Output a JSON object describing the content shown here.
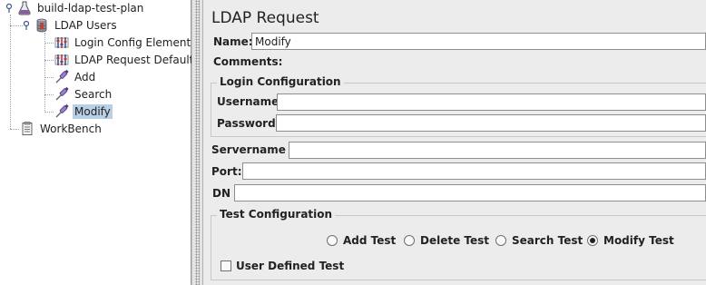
{
  "tree": {
    "root": {
      "label": "build-ldap-test-plan",
      "icon": "test-plan-icon"
    },
    "thread_group": {
      "label": "LDAP Users",
      "icon": "thread-group-icon"
    },
    "children": [
      {
        "label": "Login Config Element",
        "icon": "config-element-icon"
      },
      {
        "label": "LDAP Request Defaults",
        "icon": "config-element-icon"
      },
      {
        "label": "Add",
        "icon": "sampler-icon"
      },
      {
        "label": "Search",
        "icon": "sampler-icon"
      },
      {
        "label": "Modify",
        "icon": "sampler-icon",
        "selected": true
      }
    ],
    "workbench": {
      "label": "WorkBench",
      "icon": "workbench-icon"
    }
  },
  "panel": {
    "title": "LDAP Request",
    "name_label": "Name:",
    "name_value": "Modify",
    "comments_label": "Comments:",
    "login_group_title": "Login Configuration",
    "username_label": "Username",
    "username_value": "",
    "password_label": "Password",
    "password_value": "",
    "servername_label": "Servername :",
    "servername_value": "",
    "port_label": "Port:",
    "port_value": "",
    "dn_label": "DN",
    "dn_value": "",
    "test_group_title": "Test Configuration",
    "radios": [
      {
        "label": "Add Test",
        "selected": false
      },
      {
        "label": "Delete Test",
        "selected": false
      },
      {
        "label": "Search Test",
        "selected": false
      },
      {
        "label": "Modify Test",
        "selected": true
      }
    ],
    "user_defined_label": "User Defined Test",
    "user_defined_checked": false
  },
  "colors": {
    "selection": "#b8cfe5",
    "panel_bg": "#ececec",
    "tree_bg": "#ffffff"
  }
}
